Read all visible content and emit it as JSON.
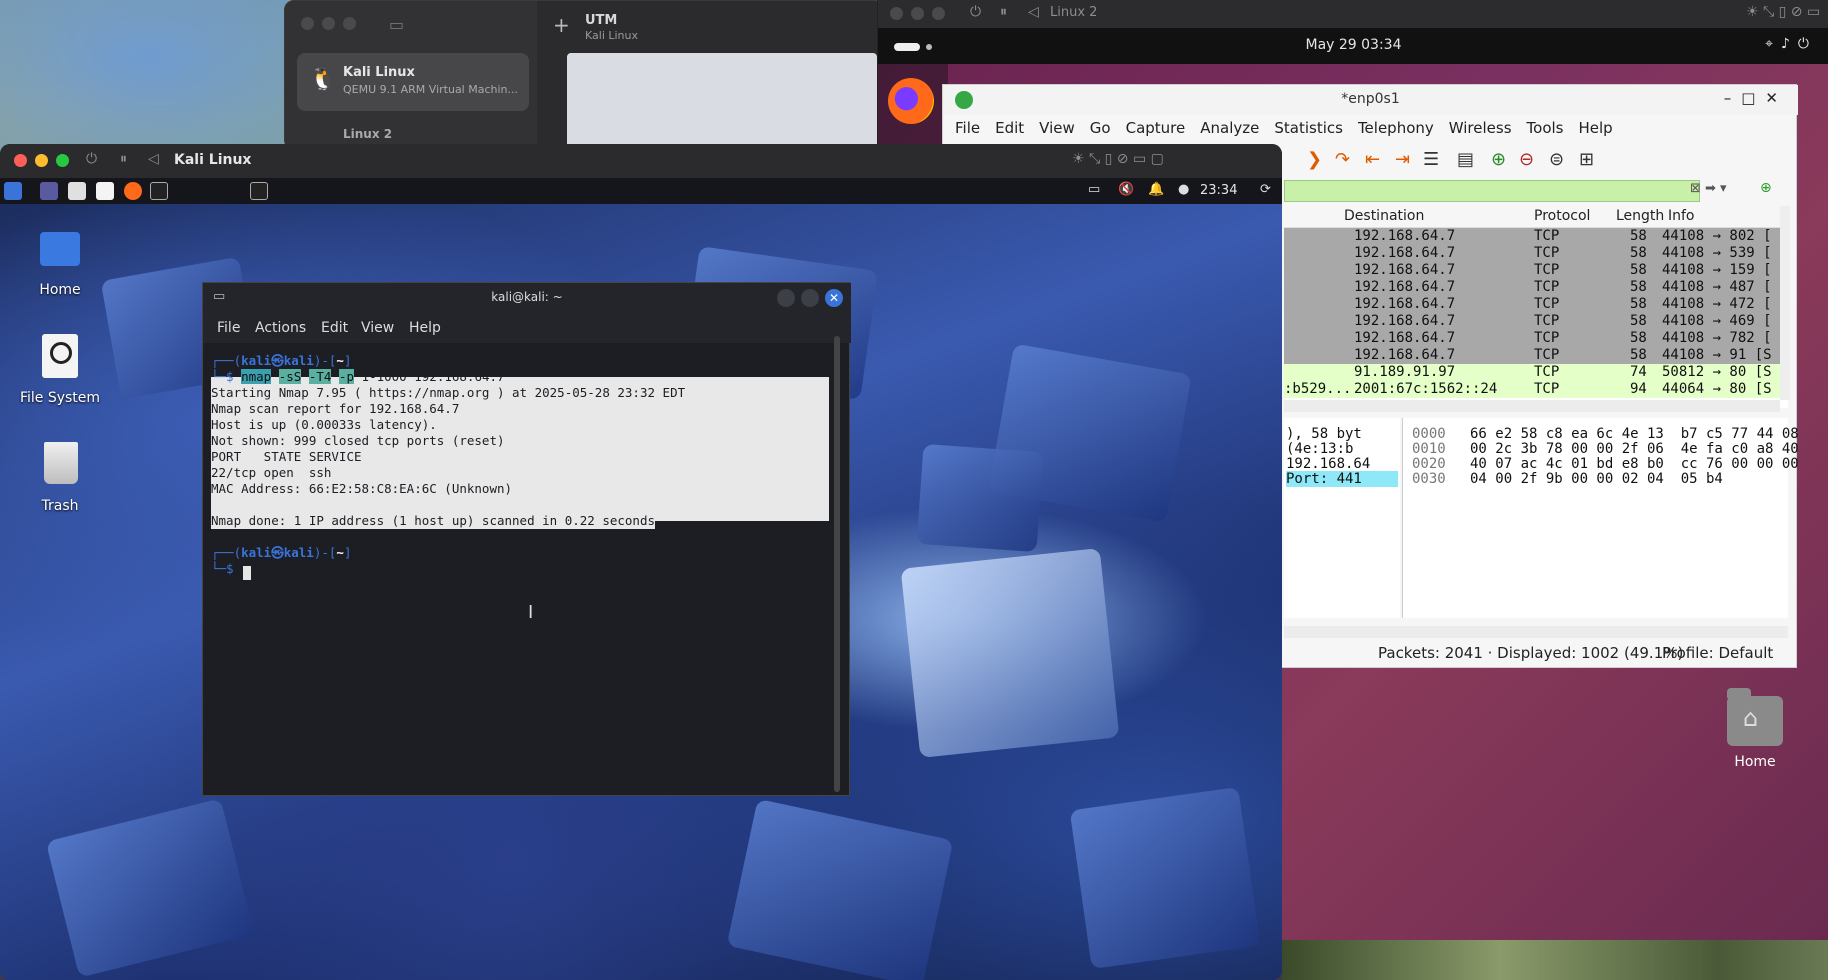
{
  "utm": {
    "title": "UTM",
    "subtitle": "Kali Linux",
    "vms": [
      {
        "name": "Kali Linux",
        "desc": "QEMU 9.1 ARM Virtual Machin..."
      },
      {
        "name": "Linux 2"
      }
    ]
  },
  "linux2": {
    "window_title": "Linux 2",
    "clock": "May 29  03:34",
    "desktop_home_label": "Home"
  },
  "wireshark": {
    "title": "*enp0s1",
    "menu": [
      "File",
      "Edit",
      "View",
      "Go",
      "Capture",
      "Analyze",
      "Statistics",
      "Telephony",
      "Wireless",
      "Tools",
      "Help"
    ],
    "columns": {
      "destination": "Destination",
      "protocol": "Protocol",
      "length": "Length",
      "info": "Info"
    },
    "rows": [
      {
        "src": "",
        "dst": "192.168.64.7",
        "proto": "TCP",
        "len": "58",
        "info": "44108 → 802 [",
        "color": "gray"
      },
      {
        "src": "",
        "dst": "192.168.64.7",
        "proto": "TCP",
        "len": "58",
        "info": "44108 → 539 [",
        "color": "gray"
      },
      {
        "src": "",
        "dst": "192.168.64.7",
        "proto": "TCP",
        "len": "58",
        "info": "44108 → 159 [",
        "color": "gray"
      },
      {
        "src": "",
        "dst": "192.168.64.7",
        "proto": "TCP",
        "len": "58",
        "info": "44108 → 487 [",
        "color": "gray"
      },
      {
        "src": "",
        "dst": "192.168.64.7",
        "proto": "TCP",
        "len": "58",
        "info": "44108 → 472 [",
        "color": "gray"
      },
      {
        "src": "",
        "dst": "192.168.64.7",
        "proto": "TCP",
        "len": "58",
        "info": "44108 → 469 [",
        "color": "gray"
      },
      {
        "src": "",
        "dst": "192.168.64.7",
        "proto": "TCP",
        "len": "58",
        "info": "44108 → 782 [",
        "color": "gray"
      },
      {
        "src": "",
        "dst": "192.168.64.7",
        "proto": "TCP",
        "len": "58",
        "info": "44108 → 91 [S",
        "color": "gray"
      },
      {
        "src": "",
        "dst": "91.189.91.97",
        "proto": "TCP",
        "len": "74",
        "info": "50812 → 80 [S",
        "color": "green"
      },
      {
        "src": ":b529...",
        "dst": "2001:67c:1562::24",
        "proto": "TCP",
        "len": "94",
        "info": "44064 → 80 [S",
        "color": "green"
      }
    ],
    "details": [
      {
        "text": "), 58 byt",
        "highlight": false
      },
      {
        "text": "(4e:13:b",
        "highlight": false
      },
      {
        "text": "192.168.64",
        "highlight": false
      },
      {
        "text": "Port: 441",
        "highlight": true
      }
    ],
    "bytes": [
      {
        "off": "0000",
        "hex": "66 e2 58 c8 ea 6c 4e 13  b7 c5 77 44 08"
      },
      {
        "off": "0010",
        "hex": "00 2c 3b 78 00 00 2f 06  4e fa c0 a8 40"
      },
      {
        "off": "0020",
        "hex": "40 07 ac 4c 01 bd e8 b0  cc 76 00 00 00"
      },
      {
        "off": "0030",
        "hex": "04 00 2f 9b 00 00 02 04  05 b4"
      }
    ],
    "status": {
      "packets": "Packets: 2041 · Displayed: 1002 (49.1%)",
      "profile": "Profile: Default"
    }
  },
  "kali": {
    "window_title": "Kali Linux",
    "panel_clock": "23:34",
    "desktop_icons": [
      {
        "label": "Home"
      },
      {
        "label": "File System"
      },
      {
        "label": "Trash"
      }
    ]
  },
  "terminal": {
    "title": "kali@kali: ~",
    "menu": [
      "File",
      "Actions",
      "Edit",
      "View",
      "Help"
    ],
    "prompt_user": "kali",
    "prompt_host": "kali",
    "prompt_dir": "~",
    "command": {
      "cmd": "nmap",
      "flag1": "-sS",
      "flag2": "-T4",
      "flag3": "-p",
      "rest": " 1-1000 192.168.64.7"
    },
    "output": [
      "Starting Nmap 7.95 ( https://nmap.org ) at 2025-05-28 23:32 EDT",
      "Nmap scan report for 192.168.64.7",
      "Host is up (0.00033s latency).",
      "Not shown: 999 closed tcp ports (reset)",
      "PORT   STATE SERVICE",
      "22/tcp open  ssh",
      "MAC Address: 66:E2:58:C8:EA:6C (Unknown)",
      "",
      "Nmap done: 1 IP address (1 host up) scanned in 0.22 seconds"
    ]
  }
}
